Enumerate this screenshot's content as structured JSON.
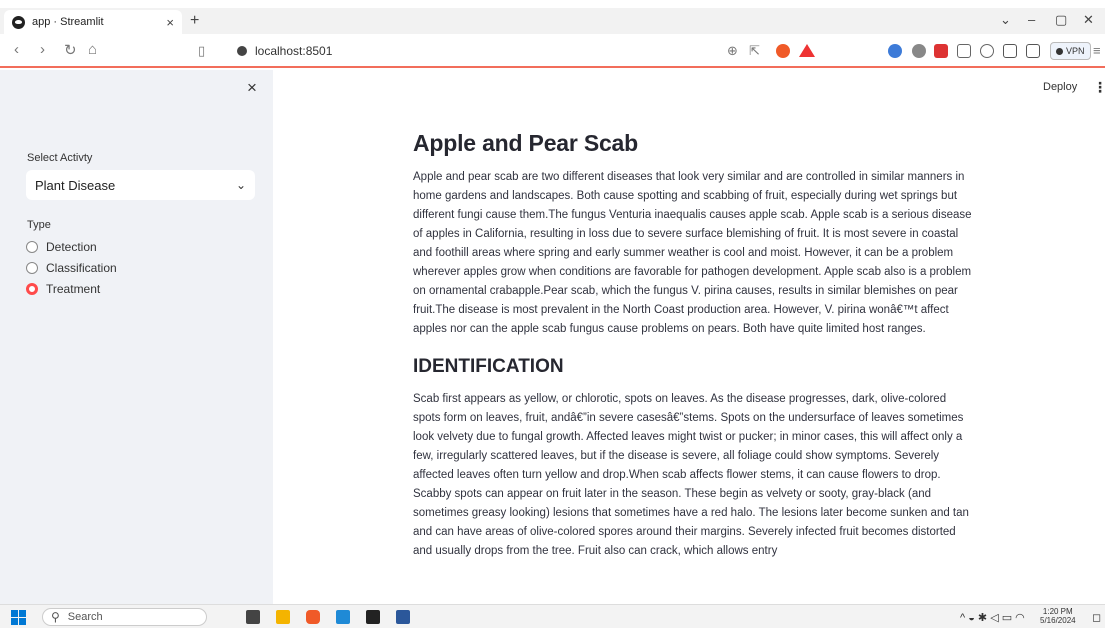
{
  "browser": {
    "tab_title": "app · Streamlit",
    "tab_close": "×",
    "new_tab": "+",
    "url": "localhost:8501",
    "vpn_label": "VPN"
  },
  "sidebar": {
    "close": "×",
    "select_label": "Select Activty",
    "select_value": "Plant Disease",
    "type_label": "Type",
    "options": [
      {
        "label": "Detection",
        "selected": false
      },
      {
        "label": "Classification",
        "selected": false
      },
      {
        "label": "Treatment",
        "selected": true
      }
    ]
  },
  "header": {
    "deploy": "Deploy",
    "menu": "⋮"
  },
  "main": {
    "title": "Apple and Pear Scab",
    "intro": "Apple and pear scab are two different diseases that look very similar and are controlled in similar manners in home gardens and landscapes. Both cause spotting and scabbing of fruit, especially during wet springs but different fungi cause them.The fungus Venturia inaequalis causes apple scab. Apple scab is a serious disease of apples in California, resulting in loss due to severe surface blemishing of fruit. It is most severe in coastal and foothill areas where spring and early summer weather is cool and moist. However, it can be a problem wherever apples grow when conditions are favorable for pathogen development. Apple scab also is a problem on ornamental crabapple.Pear scab, which the fungus V. pirina causes, results in similar blemishes on pear fruit.The disease is most prevalent in the North Coast production area. However, V. pirina wonâ€™t affect apples nor can the apple scab fungus cause problems on pears. Both have quite limited host ranges.",
    "section_heading": "IDENTIFICATION",
    "identification": "Scab first appears as yellow, or chlorotic, spots on leaves. As the disease progresses, dark, olive-colored spots form on leaves, fruit, andâ€”in severe casesâ€”stems. Spots on the undersurface of leaves sometimes look velvety due to fungal growth. Affected leaves might twist or pucker; in minor cases, this will affect only a few, irregularly scattered leaves, but if the disease is severe, all foliage could show symptoms. Severely affected leaves often turn yellow and drop.When scab affects flower stems, it can cause flowers to drop. Scabby spots can appear on fruit later in the season. These begin as velvety or sooty, gray-black (and sometimes greasy looking) lesions that sometimes have a red halo. The lesions later become sunken and tan and can have areas of olive-colored spores around their margins. Severely infected fruit becomes distorted and usually drops from the tree. Fruit also can crack, which allows entry"
  },
  "taskbar": {
    "search_placeholder": "Search",
    "time": "1:20 PM",
    "date": "5/16/2024"
  },
  "colors": {
    "accent": "#ff4b4b",
    "sidebar_bg": "#f0f2f6",
    "toolbar_border": "#f26d5b"
  }
}
